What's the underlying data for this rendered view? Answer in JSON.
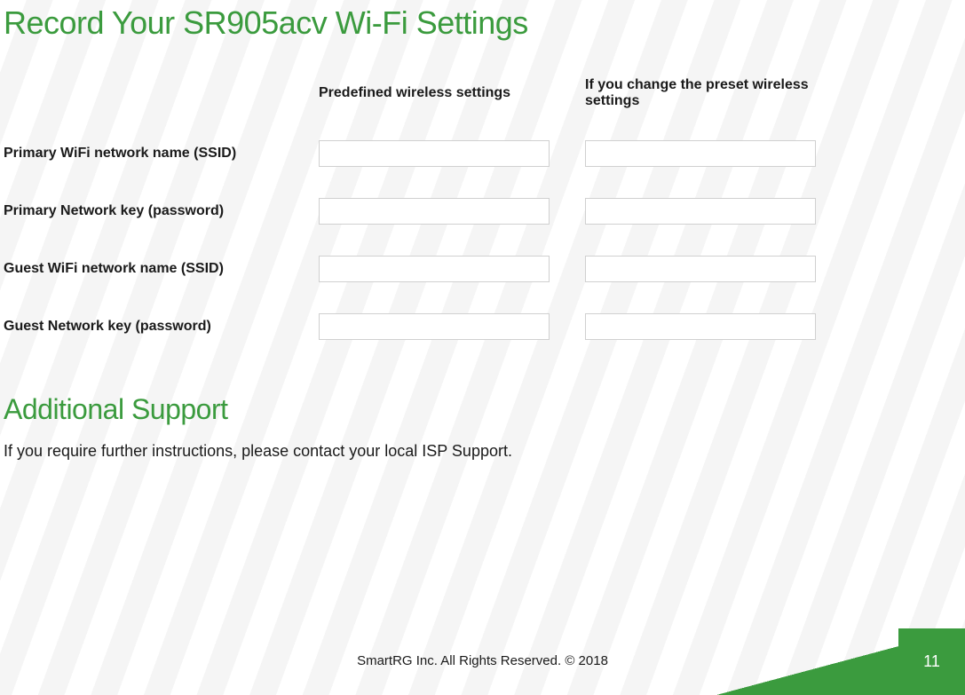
{
  "title": "Record Your SR905acv Wi-Fi Settings",
  "columns": {
    "predefined": "Predefined wireless settings",
    "changed": "If you change the preset wireless settings"
  },
  "rows": {
    "primary_ssid": "Primary WiFi network name (SSID)",
    "primary_key": "Primary Network key (password)",
    "guest_ssid": "Guest WiFi network name (SSID)",
    "guest_key": "Guest Network key (password)"
  },
  "values": {
    "primary_ssid_predefined": "",
    "primary_ssid_changed": "",
    "primary_key_predefined": "",
    "primary_key_changed": "",
    "guest_ssid_predefined": "",
    "guest_ssid_changed": "",
    "guest_key_predefined": "",
    "guest_key_changed": ""
  },
  "support": {
    "heading": "Additional Support",
    "text": "If you require further instructions, please contact your local ISP Support."
  },
  "footer": {
    "copyright": "SmartRG Inc. All Rights Reserved. © 2018",
    "page": "11"
  }
}
